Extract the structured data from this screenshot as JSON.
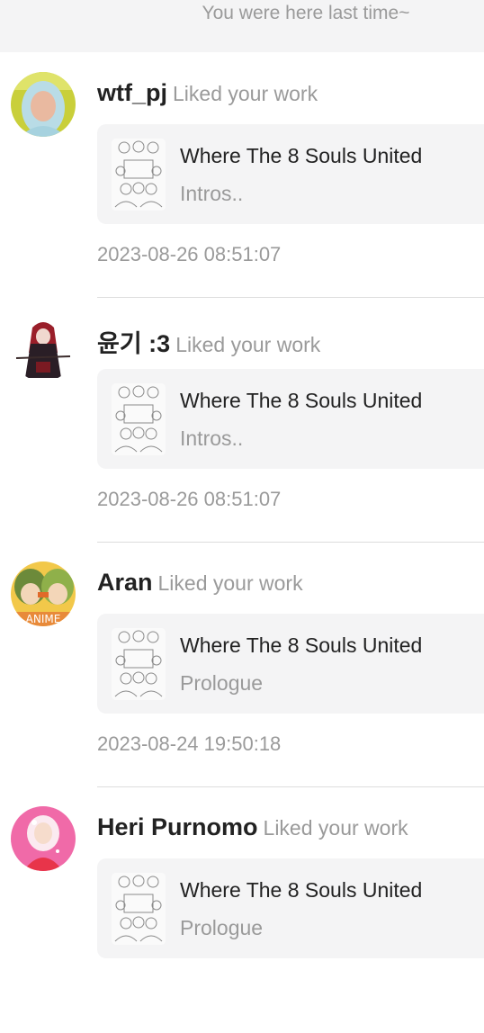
{
  "banner": {
    "text": "You were here last time~"
  },
  "notifications": [
    {
      "user": "wtf_pj",
      "action": "Liked your work",
      "work_title": "Where The 8 Souls United",
      "chapter": "Intros..",
      "time": "2023-08-26 08:51:07",
      "avatar": "hijab-woman-avatar"
    },
    {
      "user": "윤기 :3",
      "action": "Liked your work",
      "work_title": "Where The 8 Souls United",
      "chapter": "Intros..",
      "time": "2023-08-26 08:51:07",
      "avatar": "red-hair-character-avatar"
    },
    {
      "user": "Aran",
      "action": "Liked your work",
      "work_title": "Where The 8 Souls United",
      "chapter": "Prologue",
      "time": "2023-08-24 19:50:18",
      "avatar": "anime-duo-avatar"
    },
    {
      "user": "Heri Purnomo",
      "action": "Liked your work",
      "work_title": "Where The 8 Souls United",
      "chapter": "Prologue",
      "time": "",
      "avatar": "pink-hijab-girl-avatar"
    }
  ],
  "colors": {
    "banner_bg": "#f4f4f5",
    "card_bg": "#f4f4f5",
    "muted_text": "#9a9a9a",
    "primary_text": "#222222"
  }
}
